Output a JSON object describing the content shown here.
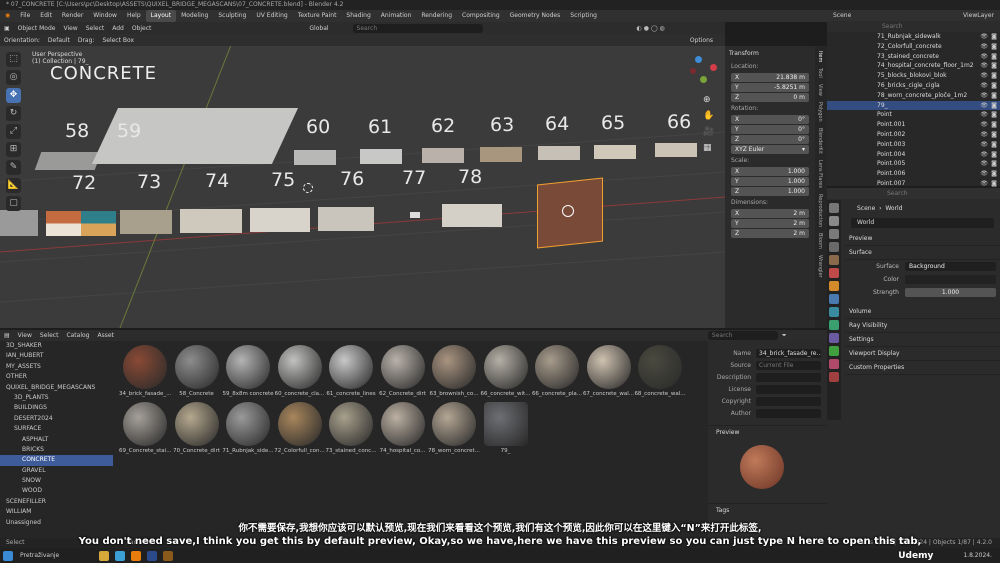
{
  "titlebar": {
    "text": "* 07_CONCRETE [C:\\Users\\pc\\Desktop\\ASSETS\\QUIXEL_BRIDGE_MEGASCANS\\07_CONCRETE.blend] - Blender 4.2"
  },
  "menu": [
    "File",
    "Edit",
    "Render",
    "Window",
    "Help"
  ],
  "workspaces": [
    "Layout",
    "Modeling",
    "Sculpting",
    "UV Editing",
    "Texture Paint",
    "Shading",
    "Animation",
    "Rendering",
    "Compositing",
    "Geometry Nodes",
    "Scripting"
  ],
  "topright": {
    "scene": "Scene",
    "viewlayer": "ViewLayer"
  },
  "viewport": {
    "mode": "Object Mode",
    "view": "View",
    "select": "Select",
    "add": "Add",
    "object": "Object",
    "orientation_label": "Orientation:",
    "orientation": "Default",
    "drag_label": "Drag:",
    "drag": "Select Box",
    "transform": "Global",
    "options": "Options",
    "overlay1": "User Perspective",
    "overlay2": "(1) Collection | 79_",
    "heading": "CONCRETE",
    "row1": [
      "58",
      "59",
      "60",
      "61",
      "62",
      "63",
      "64",
      "65",
      "66"
    ],
    "row2": [
      "72",
      "73",
      "74",
      "75",
      "76",
      "77",
      "78"
    ]
  },
  "npanel": {
    "title": "Transform",
    "location": "Location:",
    "loc": [
      {
        "a": "X",
        "v": "21.838 m"
      },
      {
        "a": "Y",
        "v": "-5.8251 m"
      },
      {
        "a": "Z",
        "v": "0 m"
      }
    ],
    "rotation": "Rotation:",
    "rot": [
      {
        "a": "X",
        "v": "0°"
      },
      {
        "a": "Y",
        "v": "0°"
      },
      {
        "a": "Z",
        "v": "0°"
      }
    ],
    "euler": "XYZ Euler",
    "scale": "Scale:",
    "scl": [
      {
        "a": "X",
        "v": "1.000"
      },
      {
        "a": "Y",
        "v": "1.000"
      },
      {
        "a": "Z",
        "v": "1.000"
      }
    ],
    "dimensions": "Dimensions:",
    "dim": [
      {
        "a": "X",
        "v": "2 m"
      },
      {
        "a": "Y",
        "v": "2 m"
      },
      {
        "a": "Z",
        "v": "2 m"
      }
    ],
    "tabs": [
      "Item",
      "Tool",
      "View",
      "Polygon",
      "BlenderKit",
      "Lens Flares",
      "Reproduction",
      "Bloom",
      "Wrangler"
    ]
  },
  "outliner": {
    "items": [
      "71_Rubnjak_sidewalk",
      "72_Colorfull_concrete",
      "73_stained_concrete",
      "74_hospital_concrete_floor_1m2",
      "75_blocks_blokovi_blok",
      "76_bricks_cigle_cigla",
      "78_worn_concrete_ploče_1m2",
      "79_",
      "Point",
      "Point.001",
      "Point.002",
      "Point.003",
      "Point.004",
      "Point.005",
      "Point.006",
      "Point.007"
    ]
  },
  "properties": {
    "scene": "Scene",
    "world_crumb": "World",
    "world": "World",
    "preview": "Preview",
    "surface": "Surface",
    "surface_label": "Surface",
    "surface_val": "Background",
    "color_label": "Color",
    "strength_label": "Strength",
    "strength": "1.000",
    "volume": "Volume",
    "ray": "Ray Visibility",
    "settings": "Settings",
    "vpdisplay": "Viewport Display",
    "custom": "Custom Properties"
  },
  "browser": {
    "menus": [
      "View",
      "Select",
      "Catalog",
      "Asset"
    ],
    "tree": [
      {
        "t": "3D_SHAKER",
        "d": 1
      },
      {
        "t": "IAN_HUBERT",
        "d": 1
      },
      {
        "t": "MY_ASSETS",
        "d": 1
      },
      {
        "t": "OTHER",
        "d": 1
      },
      {
        "t": "QUIXEL_BRIDGE_MEGASCANS",
        "d": 1
      },
      {
        "t": "3D_PLANTS",
        "d": 2
      },
      {
        "t": "BUILDINGS",
        "d": 2
      },
      {
        "t": "DESERT2024",
        "d": 2
      },
      {
        "t": "SURFACE",
        "d": 2
      },
      {
        "t": "ASPHALT",
        "d": 3
      },
      {
        "t": "BRICKS",
        "d": 3
      },
      {
        "t": "CONCRETE",
        "d": 3,
        "sel": true
      },
      {
        "t": "GRAVEL",
        "d": 3
      },
      {
        "t": "SNOW",
        "d": 3
      },
      {
        "t": "WOOD",
        "d": 3
      },
      {
        "t": "SCENEFILLER",
        "d": 1
      },
      {
        "t": "WILLIAM",
        "d": 1
      },
      {
        "t": "Unassigned",
        "d": 1
      }
    ],
    "assets": [
      {
        "n": "34_brick_fasade_...",
        "c": "#8a4a35"
      },
      {
        "n": "58_Concrete",
        "c": "#8d8d8d"
      },
      {
        "n": "59_8x8m concrete",
        "c": "#b4b4b4"
      },
      {
        "n": "60_concrete_cla...",
        "c": "#c2c2c0"
      },
      {
        "n": "61_concrete_lines",
        "c": "#c8c8c8"
      },
      {
        "n": "62_Concrete_dirt",
        "c": "#b9b2aa"
      },
      {
        "n": "63_brownish_co...",
        "c": "#a99480"
      },
      {
        "n": "66_concrete_wit...",
        "c": "#b5b0a6"
      },
      {
        "n": "66_concrete_pla...",
        "c": "#a89c8c"
      },
      {
        "n": "67_concrete_wal...",
        "c": "#cfc2b0"
      },
      {
        "n": "68_concrete_wal...",
        "c": "#4a4a3f"
      },
      {
        "n": "69_Concrete_stai...",
        "c": "#a5a099"
      },
      {
        "n": "70_Concrete_dirt",
        "c": "#b5a88e"
      },
      {
        "n": "71_Rubnjak_side...",
        "c": "#9a9a9a"
      },
      {
        "n": "72_Colorfull_con...",
        "c": "#a8865c"
      },
      {
        "n": "73_stained_conc...",
        "c": "#a8a08c"
      },
      {
        "n": "74_hospital_co...",
        "c": "#bcb0a2"
      },
      {
        "n": "78_worn_concret...",
        "c": "#b4a694"
      },
      {
        "n": "79_",
        "c": "#6e6f74"
      }
    ],
    "meta": {
      "name_l": "Name",
      "name": "34_brick_fasade_re...",
      "source_l": "Source",
      "source": "Current File",
      "desc_l": "Description",
      "license_l": "License",
      "copyright_l": "Copyright",
      "author_l": "Author",
      "preview": "Preview",
      "tags": "Tags"
    },
    "search_ph": "Search"
  },
  "subtitle": {
    "cn": "你不需要保存,我想你应该可以默认预览,现在我们来看看这个预览,我们有这个预览,因此你可以在这里键入“N”来打开此标签,",
    "en": "You don't need save,I think you get this by default preview, Okay,so we have,here we have this preview so you can just type N here to open this tab,"
  },
  "status": {
    "left": "Select",
    "pan": "Pan View",
    "right": "Verts 3,789 | Tris 3,824 | Objects 1/87 | 4.2.0"
  },
  "taskbar": {
    "search": "Pretraživanje",
    "time": "1.8.2024."
  },
  "brand": "Udemy"
}
